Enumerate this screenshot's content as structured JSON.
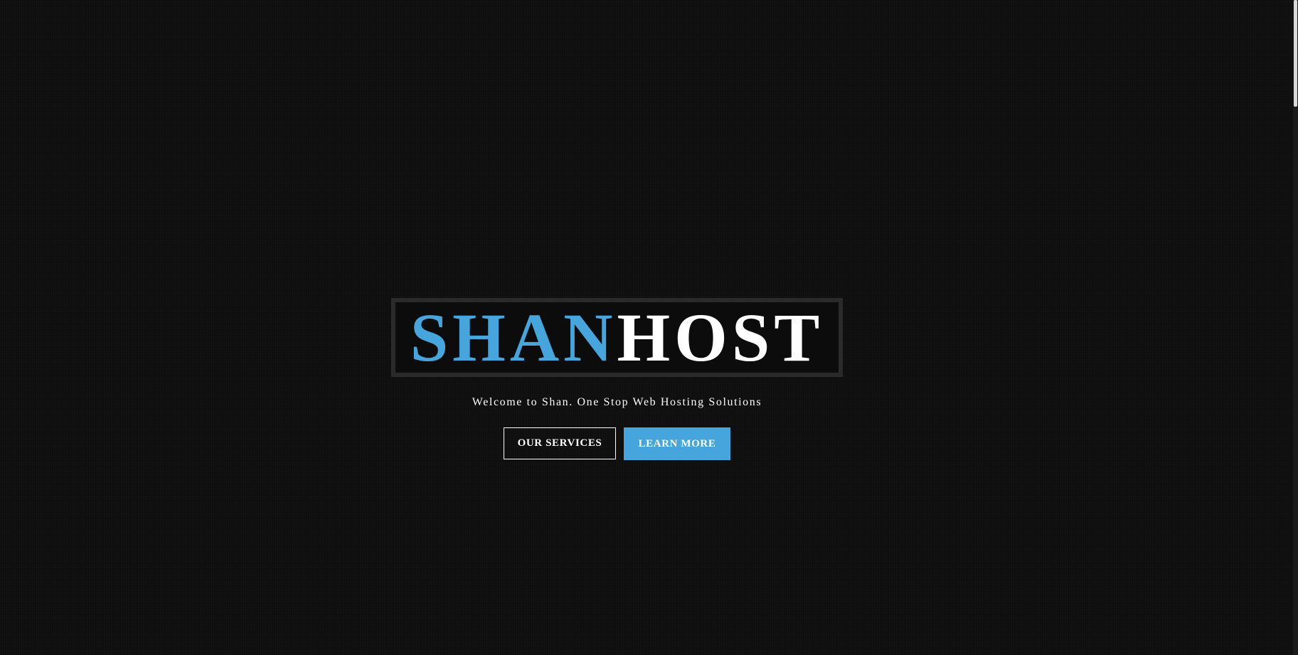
{
  "hero": {
    "logo": {
      "part1": "SHAN",
      "part2": "HOST"
    },
    "tagline": "Welcome to Shan. One Stop Web Hosting Solutions",
    "buttons": {
      "services": "OUR SERVICES",
      "learn_more": "LEARN MORE"
    }
  },
  "colors": {
    "accent": "#45a5dc",
    "background": "#0e0e0e",
    "text": "#ffffff",
    "logo_border": "#2a2a2a"
  }
}
